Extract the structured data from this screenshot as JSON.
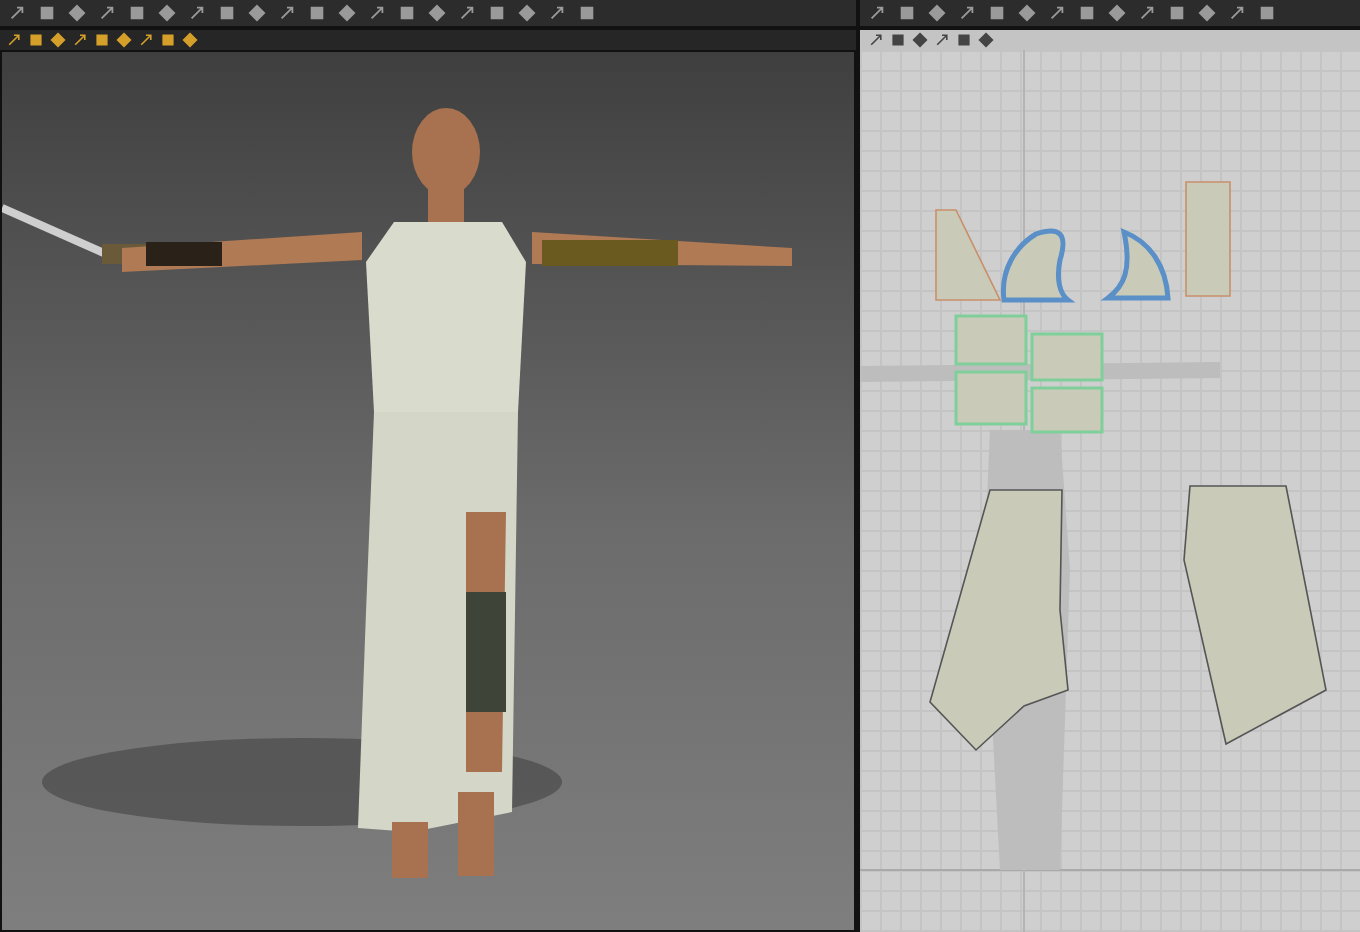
{
  "pattern_pieces": [
    {
      "kind": "fan",
      "selected": false
    },
    {
      "kind": "collar_left",
      "selected": true
    },
    {
      "kind": "collar_right",
      "selected": true
    },
    {
      "kind": "strip",
      "selected": false
    },
    {
      "kind": "panel_a",
      "selected": false
    },
    {
      "kind": "panel_b",
      "selected": false
    },
    {
      "kind": "panel_c",
      "selected": false
    },
    {
      "kind": "panel_d",
      "selected": false
    },
    {
      "kind": "skirt_left",
      "selected": false
    },
    {
      "kind": "skirt_right",
      "selected": false
    }
  ]
}
